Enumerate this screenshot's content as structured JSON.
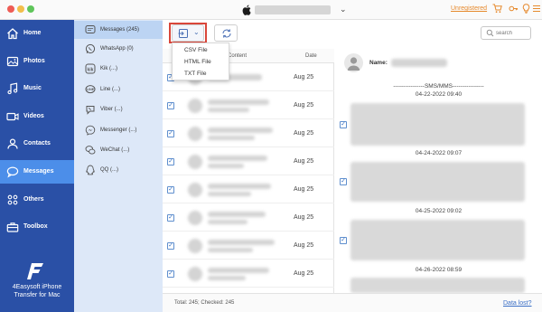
{
  "titlebar": {
    "unregistered_label": "Unregistered",
    "icons": [
      "cart-icon",
      "key-icon",
      "lightbulb-icon",
      "menu-icon"
    ]
  },
  "sidebar": {
    "items": [
      {
        "label": "Home",
        "icon": "home-icon"
      },
      {
        "label": "Photos",
        "icon": "photos-icon"
      },
      {
        "label": "Music",
        "icon": "music-icon"
      },
      {
        "label": "Videos",
        "icon": "videos-icon"
      },
      {
        "label": "Contacts",
        "icon": "contacts-icon"
      },
      {
        "label": "Messages",
        "icon": "messages-icon",
        "active": true
      },
      {
        "label": "Others",
        "icon": "others-icon"
      },
      {
        "label": "Toolbox",
        "icon": "toolbox-icon"
      }
    ],
    "brand": {
      "line1": "4Easysoft iPhone",
      "line2": "Transfer for Mac"
    }
  },
  "categories": {
    "items": [
      {
        "label": "Messages (245)",
        "icon": "message-bubble-icon",
        "active": true
      },
      {
        "label": "WhatsApp (0)",
        "icon": "whatsapp-icon"
      },
      {
        "label": "Kik (...)",
        "icon": "kik-icon"
      },
      {
        "label": "Line (...)",
        "icon": "line-icon"
      },
      {
        "label": "Viber (...)",
        "icon": "viber-icon"
      },
      {
        "label": "Messenger (...)",
        "icon": "messenger-icon"
      },
      {
        "label": "WeChat (...)",
        "icon": "wechat-icon"
      },
      {
        "label": "QQ (...)",
        "icon": "qq-icon"
      }
    ]
  },
  "toolbar": {
    "search_placeholder": "search",
    "export_menu": [
      "CSV File",
      "HTML File",
      "TXT File"
    ]
  },
  "list": {
    "headers": {
      "content": "Content",
      "date": "Date"
    },
    "rows": [
      {
        "date": "Aug 25"
      },
      {
        "date": "Aug 25"
      },
      {
        "date": "Aug 25"
      },
      {
        "date": "Aug 25"
      },
      {
        "date": "Aug 25"
      },
      {
        "date": "Aug 25"
      },
      {
        "date": "Aug 25"
      },
      {
        "date": "Aug 25"
      },
      {
        "date": "Aug 25"
      }
    ]
  },
  "detail": {
    "name_label": "Name:",
    "section_header": "----------------SMS/MMS----------------",
    "timestamps": [
      "04-22-2022 09:40",
      "04-24-2022 09:07",
      "04-25-2022 09:02",
      "04-26-2022 08:59"
    ]
  },
  "footer": {
    "total": "Total: 245; Checked: 245",
    "data_lost": "Data lost?"
  },
  "colors": {
    "sidebar_bg": "#2a50a6",
    "sidebar_active": "#4c8ee9",
    "category_bg": "#dde8f8",
    "accent_orange": "#e6892c",
    "link_blue": "#3a6fc6",
    "highlight_red": "#d9463a"
  }
}
